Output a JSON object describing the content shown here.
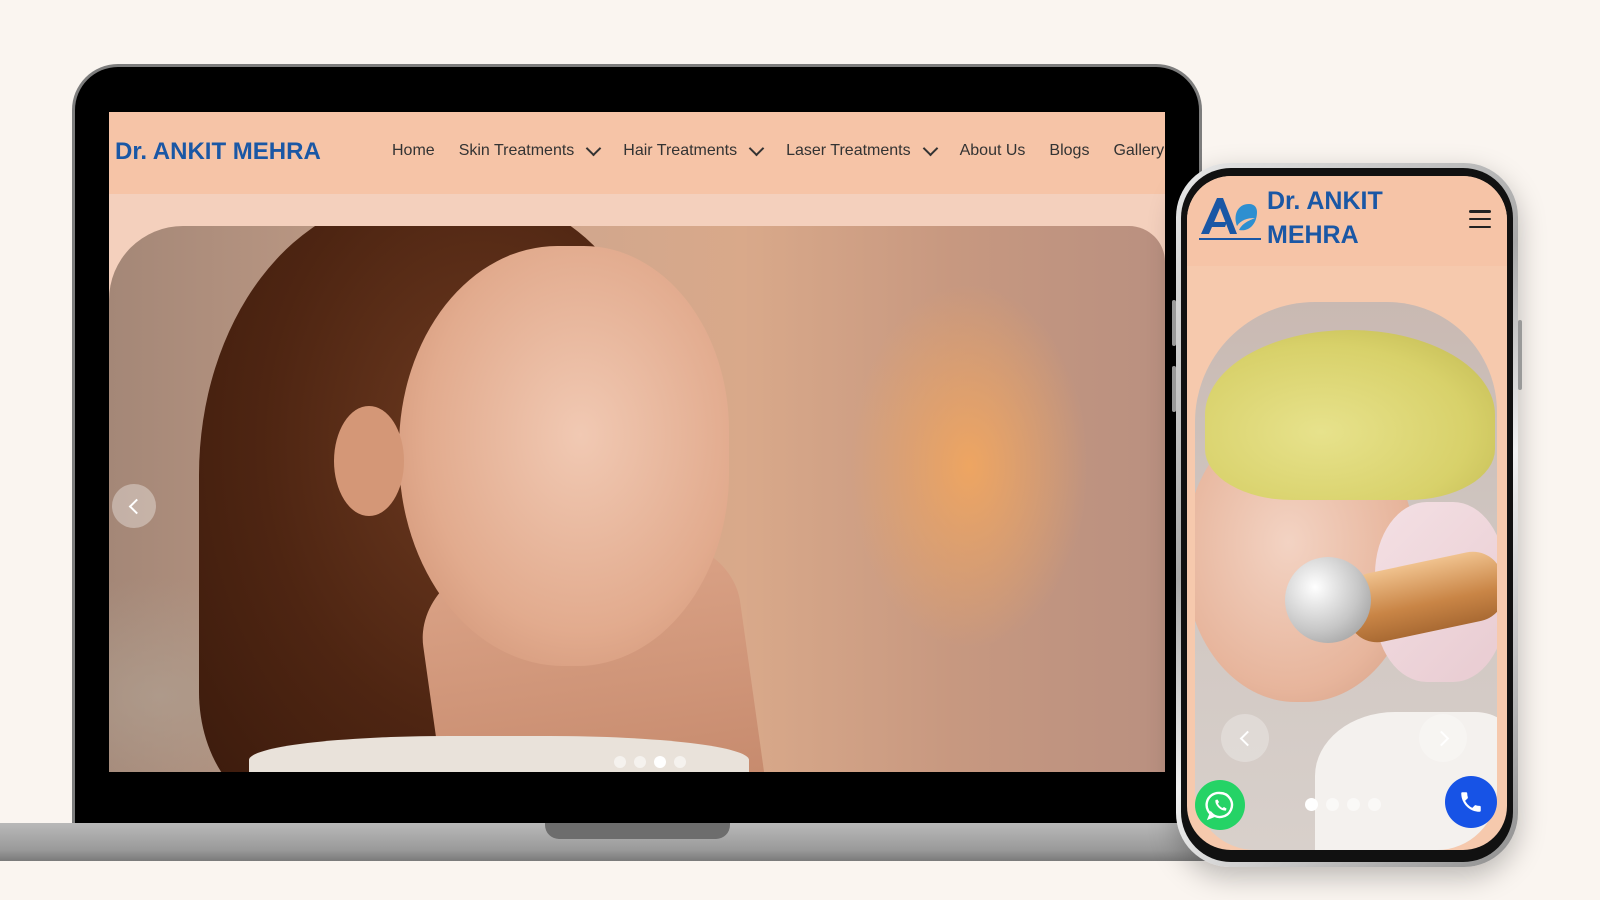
{
  "laptop": {
    "nav": {
      "logo": "Dr. ANKIT MEHRA",
      "items": [
        {
          "label": "Home",
          "dropdown": false
        },
        {
          "label": "Skin Treatments",
          "dropdown": true
        },
        {
          "label": "Hair Treatments",
          "dropdown": true
        },
        {
          "label": "Laser Treatments",
          "dropdown": true
        },
        {
          "label": "About Us",
          "dropdown": false
        },
        {
          "label": "Blogs",
          "dropdown": false
        },
        {
          "label": "Gallery",
          "dropdown": false
        }
      ]
    },
    "hero": {
      "slide_count": 4,
      "active_slide": 3
    }
  },
  "phone": {
    "nav": {
      "logo_line1": "Dr. ANKIT",
      "logo_line2": "MEHRA",
      "menu_icon": "hamburger-icon"
    },
    "hero": {
      "slide_count": 4,
      "active_slide": 1
    },
    "floating": {
      "whatsapp_icon": "whatsapp-icon",
      "call_icon": "phone-icon"
    }
  },
  "colors": {
    "background": "#faf5f0",
    "nav_bg": "#f6c4a7",
    "brand_blue": "#1a57a5",
    "whatsapp_green": "#25d366",
    "call_blue": "#1753e6"
  }
}
